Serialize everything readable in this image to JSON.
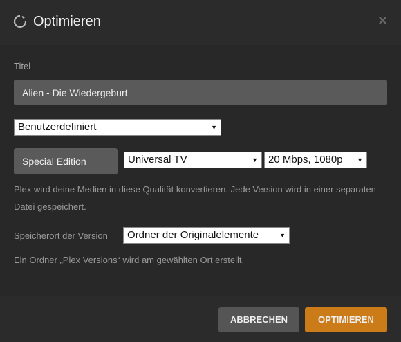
{
  "dialog": {
    "title": "Optimieren",
    "close": "×"
  },
  "form": {
    "title_label": "Titel",
    "title_value": "Alien - Die Wiedergeburt",
    "preset_select": "Benutzerdefiniert",
    "edition_button": "Special Edition",
    "device_select": "Universal TV",
    "quality_select": "20 Mbps, 1080p",
    "help_text": "Plex wird deine Medien in diese Qualität konvertieren. Jede Version wird in einer separaten Datei gespeichert.",
    "location_label": "Speicherort der Version",
    "location_select": "Ordner der Originalelemente",
    "location_help": "Ein Ordner „Plex Versions“ wird am gewählten Ort erstellt."
  },
  "footer": {
    "cancel": "ABBRECHEN",
    "optimize": "OPTIMIEREN"
  },
  "colors": {
    "accent": "#cc7b19",
    "background": "#2b2b2b"
  },
  "icons": {
    "header": "spinner-icon",
    "close": "close-icon",
    "caret": "caret-down-icon"
  }
}
